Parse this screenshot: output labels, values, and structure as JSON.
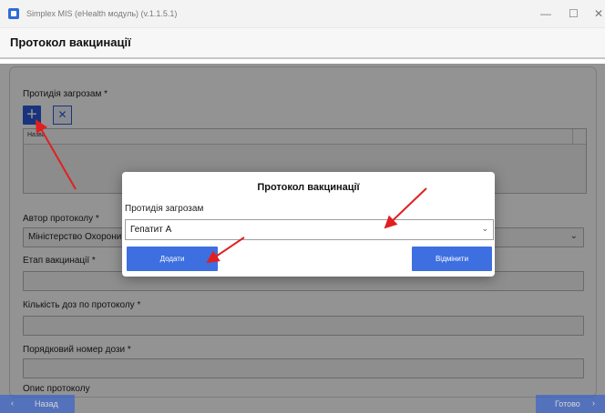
{
  "window": {
    "title": "Simplex MIS (eHealth модуль) (v.1.1.5.1)",
    "minimize_glyph": "—",
    "maximize_glyph": "☐",
    "close_glyph": "✕"
  },
  "header": {
    "title": "Протокол вакцинації"
  },
  "form": {
    "threats_label": "Протидія загрозам *",
    "add_glyph": "+",
    "delete_glyph": "✕",
    "table_column": "Назва",
    "author_label": "Автор протоколу *",
    "author_value": "Міністерство Охорони З",
    "stage_label": "Етап вакцинації *",
    "doses_label": "Кількість доз по протоколу *",
    "dose_number_label": "Порядковий номер дози *",
    "description_label": "Опис протоколу"
  },
  "footer": {
    "back_label": "Назад",
    "back_arrow": "‹",
    "done_label": "Готово",
    "done_arrow": "›"
  },
  "modal": {
    "title": "Протокол вакцинації",
    "field_label": "Протидія загрозам",
    "selected_value": "Гепатит А",
    "add_button": "Додати",
    "cancel_button": "Відмінити"
  },
  "colors": {
    "accent": "#2b5bd6",
    "annotation_arrow": "#e02020"
  }
}
